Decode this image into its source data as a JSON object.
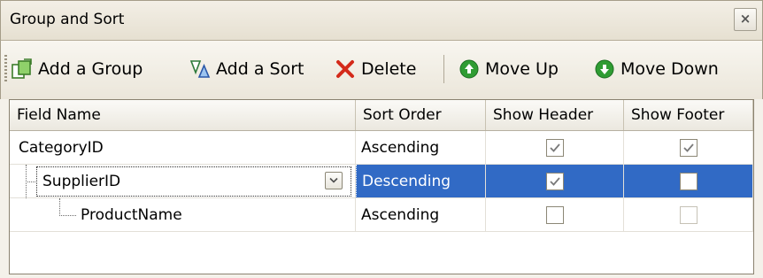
{
  "window": {
    "title": "Group and Sort",
    "close_label": "×"
  },
  "toolbar": {
    "add_group": "Add a Group",
    "add_sort": "Add a Sort",
    "delete": "Delete",
    "move_up": "Move Up",
    "move_down": "Move Down"
  },
  "grid": {
    "columns": [
      "Field Name",
      "Sort Order",
      "Show Header",
      "Show Footer"
    ],
    "rows": [
      {
        "field": "CategoryID",
        "sort": "Ascending",
        "show_header": true,
        "show_footer": true,
        "level": 0,
        "selected": false
      },
      {
        "field": "SupplierID",
        "sort": "Descending",
        "show_header": true,
        "show_footer": false,
        "level": 1,
        "selected": true
      },
      {
        "field": "ProductName",
        "sort": "Ascending",
        "show_header": false,
        "show_footer": false,
        "level": 2,
        "selected": false
      }
    ]
  },
  "colors": {
    "selection": "#316ac5",
    "delete_icon": "#d42a1a",
    "move_icon": "#2f9c33"
  }
}
